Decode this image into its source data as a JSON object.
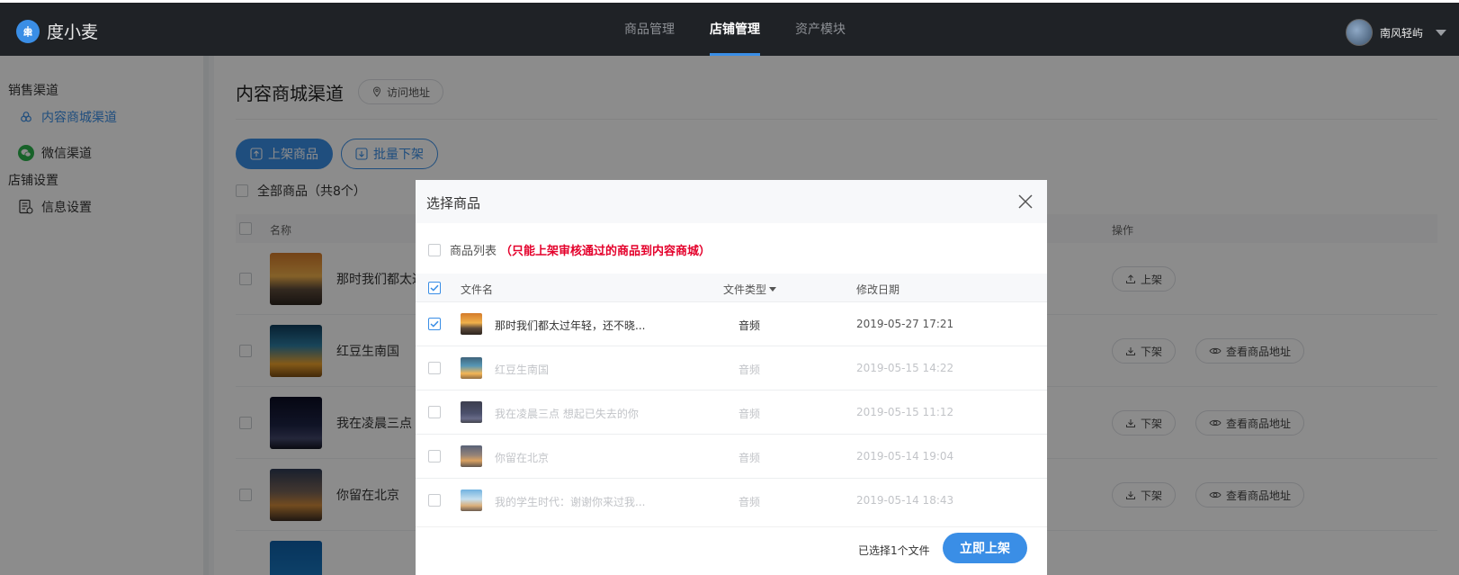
{
  "app": {
    "logo_text": "度小麦",
    "brand_color": "#3a8ee6"
  },
  "nav": {
    "items": [
      {
        "label": "商品管理",
        "active": false
      },
      {
        "label": "店铺管理",
        "active": true
      },
      {
        "label": "资产模块",
        "active": false
      }
    ]
  },
  "user": {
    "name": "南风轻屿"
  },
  "sidebar": {
    "groups": [
      {
        "title": "销售渠道",
        "items": [
          {
            "label": "内容商城渠道",
            "icon": "link-icon",
            "active": true
          },
          {
            "label": "微信渠道",
            "icon": "wechat-icon",
            "active": false
          }
        ]
      },
      {
        "title": "店铺设置",
        "items": [
          {
            "label": "信息设置",
            "icon": "document-icon",
            "active": false
          }
        ]
      }
    ]
  },
  "main": {
    "title": "内容商城渠道",
    "visit_label": "访问地址",
    "list_btn": "上架商品",
    "batch_btn": "批量下架",
    "all_goods": "全部商品（共8个）",
    "columns": {
      "name": "名称",
      "op": "操作"
    },
    "rows": [
      {
        "name": "那时我们都太过",
        "actions": [
          "上架"
        ]
      },
      {
        "name": "红豆生南国",
        "actions": [
          "下架",
          "查看商品地址"
        ]
      },
      {
        "name": "我在凌晨三点",
        "actions": [
          "下架",
          "查看商品地址"
        ]
      },
      {
        "name": "你留在北京",
        "actions": [
          "下架",
          "查看商品地址"
        ]
      }
    ]
  },
  "modal": {
    "title": "选择商品",
    "list_label": "商品列表",
    "warning": "（只能上架审核通过的商品到内容商城）",
    "columns": {
      "file": "文件名",
      "type": "文件类型",
      "date": "修改日期"
    },
    "rows": [
      {
        "name": "那时我们都太过年轻，还不晓...",
        "type": "音频",
        "date": "2019-05-27 17:21",
        "checked": true,
        "disabled": false
      },
      {
        "name": "红豆生南国",
        "type": "音频",
        "date": "2019-05-15 14:22",
        "checked": false,
        "disabled": true
      },
      {
        "name": "我在凌晨三点 想起已失去的你",
        "type": "音频",
        "date": "2019-05-15 11:12",
        "checked": false,
        "disabled": true
      },
      {
        "name": "你留在北京",
        "type": "音频",
        "date": "2019-05-14 19:04",
        "checked": false,
        "disabled": true
      },
      {
        "name": "我的学生时代：谢谢你来过我...",
        "type": "音频",
        "date": "2019-05-14 18:43",
        "checked": false,
        "disabled": true
      }
    ],
    "selected_count": "已选择1个文件",
    "submit": "立即上架"
  }
}
